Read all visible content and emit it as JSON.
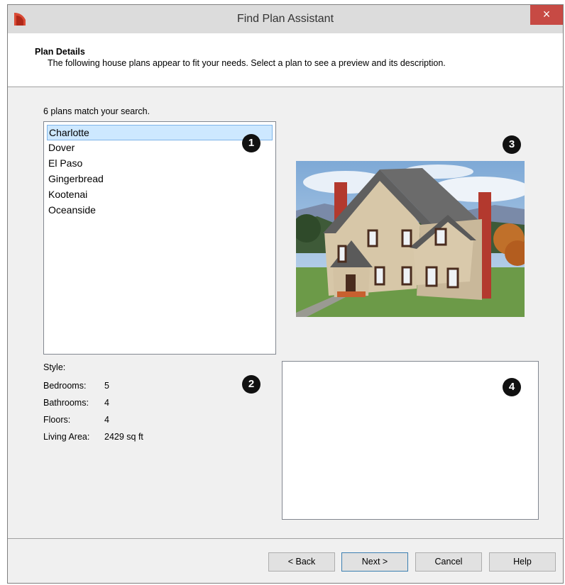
{
  "window": {
    "title": "Find Plan Assistant",
    "close_glyph": "×",
    "logo_icon": "chief-architect-logo-icon"
  },
  "header": {
    "title": "Plan Details",
    "description": "The following house plans appear to fit your needs. Select a plan to see a preview and its description."
  },
  "plans": {
    "match_text": "6 plans match your search.",
    "items": [
      "Charlotte",
      "Dover",
      "El Paso",
      "Gingerbread",
      "Kootenai",
      "Oceanside"
    ],
    "selected": "Charlotte"
  },
  "badges": {
    "list": "1",
    "details": "2",
    "preview": "3",
    "description": "4"
  },
  "details": {
    "style_label": "Style:",
    "style_value": "",
    "bedrooms_label": "Bedrooms:",
    "bedrooms_value": "5",
    "bathrooms_label": "Bathrooms:",
    "bathrooms_value": "4",
    "floors_label": "Floors:",
    "floors_value": "4",
    "living_area_label": "Living Area:",
    "living_area_value": "2429 sq ft"
  },
  "description_box": {
    "text": ""
  },
  "buttons": {
    "back": "< Back",
    "next": "Next >",
    "cancel": "Cancel",
    "help": "Help"
  },
  "colors": {
    "close_button": "#c74a44",
    "selection": "#cde8ff",
    "brand_red": "#c0392b"
  }
}
